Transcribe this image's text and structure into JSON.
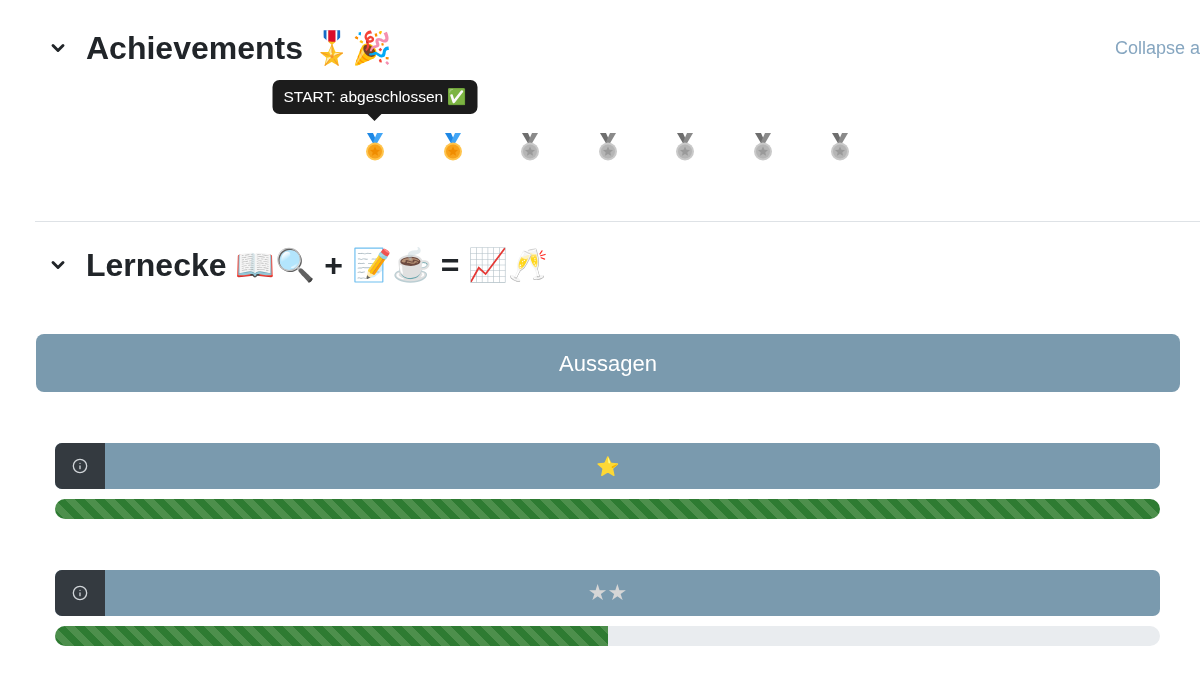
{
  "achievements": {
    "title": "Achievements 🎖️🎉",
    "expanded": true,
    "collapse_link": "Collapse a",
    "medals": [
      {
        "completed": true,
        "tooltip": "START: abgeschlossen ✅"
      },
      {
        "completed": true
      },
      {
        "completed": false
      },
      {
        "completed": false
      },
      {
        "completed": false
      },
      {
        "completed": false
      },
      {
        "completed": false
      }
    ]
  },
  "lernecke": {
    "title": "Lernecke 📖🔍 + 📝☕ = 📈🥂",
    "expanded": true,
    "button": "Aussagen",
    "cards": [
      {
        "badge": "⭐",
        "completed": true,
        "level": 1
      },
      {
        "badge": "★★",
        "completed": false,
        "level": 0.5
      }
    ]
  }
}
